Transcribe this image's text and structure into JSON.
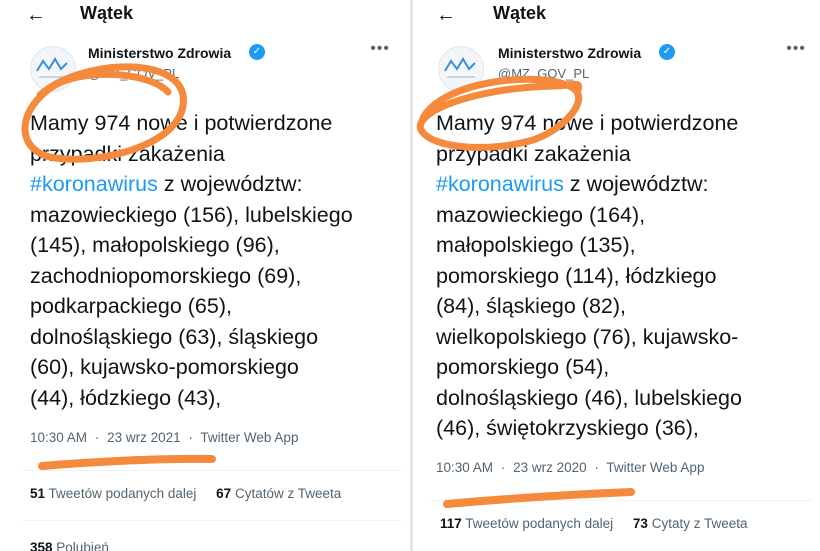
{
  "header": {
    "title": "Wątek",
    "back_icon": "arrow-left-icon"
  },
  "tweets": [
    {
      "author": "Ministerstwo Zdrowia",
      "verified_icon": "✓",
      "handle": "@MZ_GOV_PL",
      "lines": [
        "Mamy 974 nowe i potwierdzone",
        "przypadki zakażenia",
        "#koronawirus",
        " z województw:",
        "mazowieckiego (156), lubelskiego",
        "(145), małopolskiego (96),",
        "zachodniopomorskiego (69),",
        "podkarpackiego (65),",
        "dolnośląskiego (63), śląskiego",
        "(60), kujawsko-pomorskiego",
        "(44), łódzkiego (43),"
      ],
      "time": "10:30 AM",
      "date": "23 wrz 2021",
      "app": "Twitter Web App",
      "dot": "·",
      "retweets_count": "51",
      "retweets_label": "Tweetów podanych dalej",
      "quotes_count": "67",
      "quotes_label": "Cytatów z Tweeta",
      "likes_count": "358",
      "likes_label": "Polubień"
    },
    {
      "author": "Ministerstwo Zdrowia",
      "verified_icon": "✓",
      "handle": "@MZ_GOV_PL",
      "lines": [
        "Mamy 974 nowe i potwierdzone",
        "przypadki zakażenia",
        "#koronawirus",
        " z województw:",
        "mazowieckiego (164),",
        "małopolskiego (135),",
        "pomorskiego (114), łódzkiego",
        "(84), śląskiego (82),",
        "wielkopolskiego (76), kujawsko-",
        "pomorskiego (54),",
        "dolnośląskiego (46), lubelskiego",
        "(46), świętokrzyskiego (36),"
      ],
      "time": "10:30 AM",
      "date": "23 wrz 2020",
      "app": "Twitter Web App",
      "dot": "·",
      "retweets_count": "117",
      "retweets_label": "Tweetów podanych dalej",
      "quotes_count": "73",
      "quotes_label": "Cytaty z Tweeta"
    }
  ],
  "colors": {
    "hashtag": "#1d9bf0",
    "muted_text": "#536471",
    "annotation_orange": "#f58a3c",
    "verified_badge": "#1d9bf0"
  }
}
